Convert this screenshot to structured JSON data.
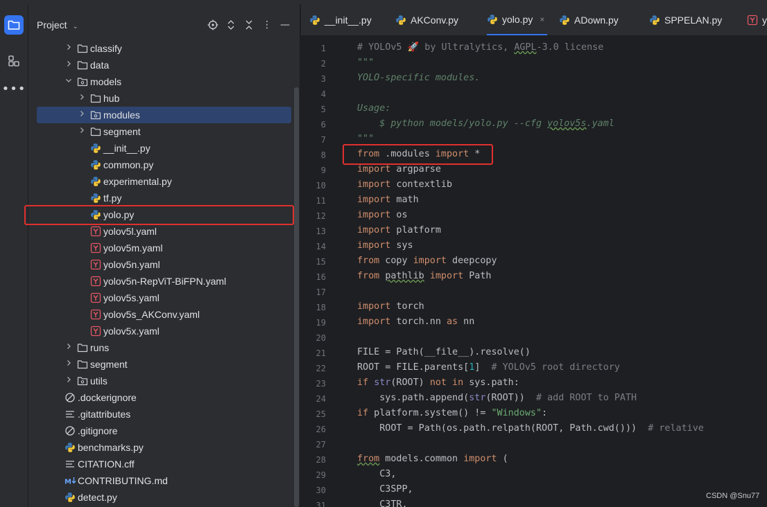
{
  "project_panel": {
    "title": "Project",
    "tree": [
      {
        "label": "classify",
        "kind": "folder",
        "depth": 2,
        "expanded": false
      },
      {
        "label": "data",
        "kind": "folder",
        "depth": 2,
        "expanded": false
      },
      {
        "label": "models",
        "kind": "package",
        "depth": 2,
        "expanded": true
      },
      {
        "label": "hub",
        "kind": "folder",
        "depth": 3,
        "expanded": false
      },
      {
        "label": "modules",
        "kind": "package",
        "depth": 3,
        "expanded": false,
        "selected": true
      },
      {
        "label": "segment",
        "kind": "folder",
        "depth": 3,
        "expanded": false
      },
      {
        "label": "__init__.py",
        "kind": "python",
        "depth": 3
      },
      {
        "label": "common.py",
        "kind": "python",
        "depth": 3
      },
      {
        "label": "experimental.py",
        "kind": "python",
        "depth": 3
      },
      {
        "label": "tf.py",
        "kind": "python",
        "depth": 3
      },
      {
        "label": "yolo.py",
        "kind": "python",
        "depth": 3,
        "highlighted": true
      },
      {
        "label": "yolov5l.yaml",
        "kind": "yaml",
        "depth": 3
      },
      {
        "label": "yolov5m.yaml",
        "kind": "yaml",
        "depth": 3
      },
      {
        "label": "yolov5n.yaml",
        "kind": "yaml",
        "depth": 3
      },
      {
        "label": "yolov5n-RepViT-BiFPN.yaml",
        "kind": "yaml",
        "depth": 3
      },
      {
        "label": "yolov5s.yaml",
        "kind": "yaml",
        "depth": 3
      },
      {
        "label": "yolov5s_AKConv.yaml",
        "kind": "yaml",
        "depth": 3
      },
      {
        "label": "yolov5x.yaml",
        "kind": "yaml",
        "depth": 3
      },
      {
        "label": "runs",
        "kind": "folder",
        "depth": 2,
        "expanded": false
      },
      {
        "label": "segment",
        "kind": "folder",
        "depth": 2,
        "expanded": false
      },
      {
        "label": "utils",
        "kind": "package",
        "depth": 2,
        "expanded": false
      },
      {
        "label": ".dockerignore",
        "kind": "ignore",
        "depth": 1
      },
      {
        "label": ".gitattributes",
        "kind": "text",
        "depth": 1
      },
      {
        "label": ".gitignore",
        "kind": "ignore",
        "depth": 1
      },
      {
        "label": "benchmarks.py",
        "kind": "python",
        "depth": 1
      },
      {
        "label": "CITATION.cff",
        "kind": "text",
        "depth": 1
      },
      {
        "label": "CONTRIBUTING.md",
        "kind": "markdown",
        "depth": 1
      },
      {
        "label": "detect.py",
        "kind": "python",
        "depth": 1
      }
    ]
  },
  "tabs": [
    {
      "label": "__init__.py",
      "icon": "python-icon"
    },
    {
      "label": "AKConv.py",
      "icon": "python-icon"
    },
    {
      "label": "yolo.py",
      "icon": "python-icon",
      "active": true,
      "close": "×"
    },
    {
      "label": "ADown.py",
      "icon": "python-icon"
    },
    {
      "label": "SPPELAN.py",
      "icon": "python-icon"
    },
    {
      "label": "yo",
      "icon": "yaml-icon"
    }
  ],
  "editor": {
    "line_numbers": [
      "1",
      "2",
      "3",
      "4",
      "5",
      "6",
      "7",
      "8",
      "9",
      "10",
      "11",
      "12",
      "13",
      "14",
      "15",
      "16",
      "17",
      "18",
      "19",
      "20",
      "21",
      "22",
      "23",
      "24",
      "25",
      "26",
      "27",
      "28",
      "29",
      "30",
      "31"
    ],
    "lines": [
      [
        {
          "t": "# YOLOv5 ",
          "c": "cm"
        },
        {
          "t": "🚀",
          "c": "cm"
        },
        {
          "t": " by Ultralytics, ",
          "c": "cm"
        },
        {
          "t": "AGPL",
          "c": "cm wavy"
        },
        {
          "t": "-3.0 license",
          "c": "cm"
        }
      ],
      [
        {
          "t": "\"\"\"",
          "c": "doc"
        }
      ],
      [
        {
          "t": "YOLO-specific modules.",
          "c": "doc"
        }
      ],
      [],
      [
        {
          "t": "Usage:",
          "c": "doc"
        }
      ],
      [
        {
          "t": "    $ python models/yolo.py --cfg ",
          "c": "doc"
        },
        {
          "t": "yolov5s",
          "c": "doc wavy"
        },
        {
          "t": ".yaml",
          "c": "doc"
        }
      ],
      [
        {
          "t": "\"\"\"",
          "c": "doc"
        }
      ],
      [
        {
          "t": "from",
          "c": "kw"
        },
        {
          "t": " .modules ",
          "c": ""
        },
        {
          "t": "import",
          "c": "kw"
        },
        {
          "t": " *",
          "c": ""
        }
      ],
      [
        {
          "t": "import",
          "c": "kw"
        },
        {
          "t": " argparse",
          "c": ""
        }
      ],
      [
        {
          "t": "import",
          "c": "kw"
        },
        {
          "t": " contextlib",
          "c": ""
        }
      ],
      [
        {
          "t": "import",
          "c": "kw"
        },
        {
          "t": " math",
          "c": ""
        }
      ],
      [
        {
          "t": "import",
          "c": "kw"
        },
        {
          "t": " os",
          "c": ""
        }
      ],
      [
        {
          "t": "import",
          "c": "kw"
        },
        {
          "t": " platform",
          "c": ""
        }
      ],
      [
        {
          "t": "import",
          "c": "kw"
        },
        {
          "t": " sys",
          "c": ""
        }
      ],
      [
        {
          "t": "from",
          "c": "kw"
        },
        {
          "t": " copy ",
          "c": ""
        },
        {
          "t": "import",
          "c": "kw"
        },
        {
          "t": " deepcopy",
          "c": ""
        }
      ],
      [
        {
          "t": "from",
          "c": "kw"
        },
        {
          "t": " ",
          "c": ""
        },
        {
          "t": "pathlib",
          "c": "wavy"
        },
        {
          "t": " ",
          "c": ""
        },
        {
          "t": "import",
          "c": "kw"
        },
        {
          "t": " Path",
          "c": ""
        }
      ],
      [],
      [
        {
          "t": "import",
          "c": "kw"
        },
        {
          "t": " torch",
          "c": ""
        }
      ],
      [
        {
          "t": "import",
          "c": "kw"
        },
        {
          "t": " torch.nn ",
          "c": ""
        },
        {
          "t": "as",
          "c": "kw"
        },
        {
          "t": " nn",
          "c": ""
        }
      ],
      [],
      [
        {
          "t": "FILE = Path(__file__).resolve()",
          "c": ""
        }
      ],
      [
        {
          "t": "ROOT = FILE.parents[",
          "c": ""
        },
        {
          "t": "1",
          "c": "num"
        },
        {
          "t": "]  ",
          "c": ""
        },
        {
          "t": "# YOLOv5 root directory",
          "c": "cm"
        }
      ],
      [
        {
          "t": "if",
          "c": "kw"
        },
        {
          "t": " ",
          "c": ""
        },
        {
          "t": "str",
          "c": "bi"
        },
        {
          "t": "(ROOT) ",
          "c": ""
        },
        {
          "t": "not in",
          "c": "kw"
        },
        {
          "t": " sys.path:",
          "c": ""
        }
      ],
      [
        {
          "t": "    sys.path.append(",
          "c": ""
        },
        {
          "t": "str",
          "c": "bi"
        },
        {
          "t": "(ROOT))  ",
          "c": ""
        },
        {
          "t": "# add ROOT to PATH",
          "c": "cm"
        }
      ],
      [
        {
          "t": "if",
          "c": "kw"
        },
        {
          "t": " platform.system() != ",
          "c": ""
        },
        {
          "t": "\"Windows\"",
          "c": "str"
        },
        {
          "t": ":",
          "c": ""
        }
      ],
      [
        {
          "t": "    ROOT = Path(os.path.relpath(ROOT, Path.cwd()))  ",
          "c": ""
        },
        {
          "t": "# relative",
          "c": "cm"
        }
      ],
      [],
      [
        {
          "t": "from",
          "c": "kw wavy"
        },
        {
          "t": " models.common ",
          "c": ""
        },
        {
          "t": "import",
          "c": "kw"
        },
        {
          "t": " (",
          "c": ""
        }
      ],
      [
        {
          "t": "    C3,",
          "c": ""
        }
      ],
      [
        {
          "t": "    C3SPP,",
          "c": ""
        }
      ],
      [
        {
          "t": "    C3TR,",
          "c": ""
        }
      ]
    ]
  },
  "watermark": "CSDN @Snu77",
  "colors": {
    "accent": "#3574f0",
    "highlight_box": "#e0302e",
    "selected_row": "#2e436e"
  }
}
